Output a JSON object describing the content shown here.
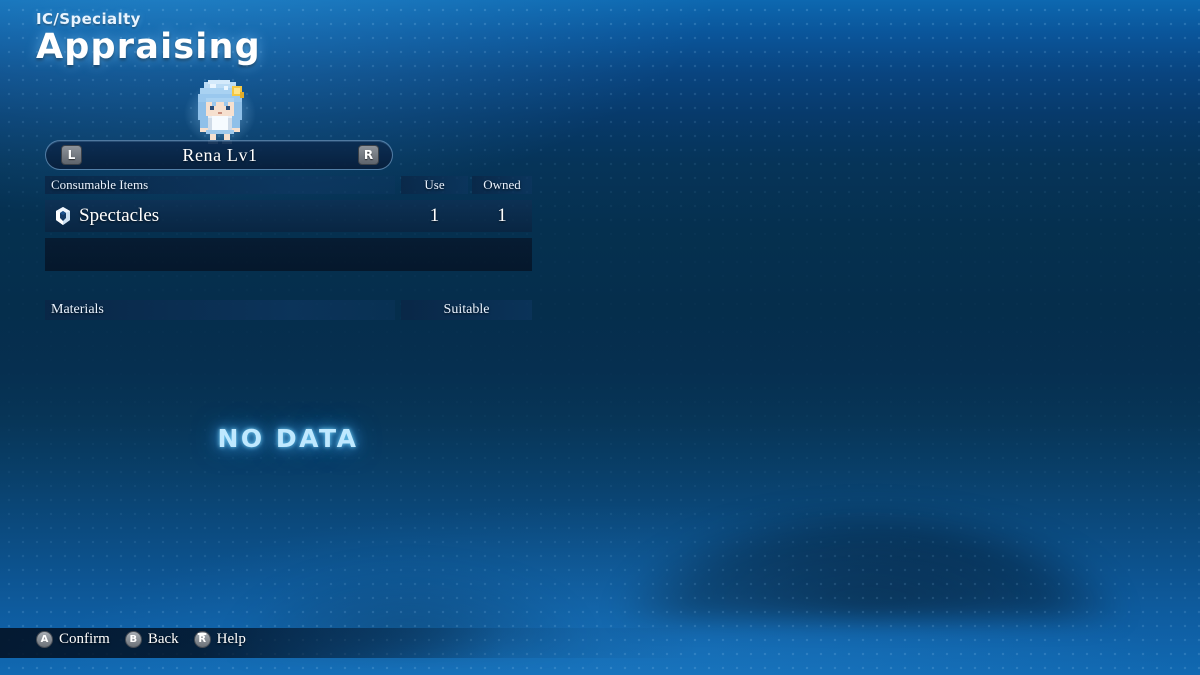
{
  "header": {
    "category": "IC/Specialty",
    "title": "Appraising"
  },
  "character": {
    "name_level": "Rena Lv1",
    "prev_button": "L",
    "next_button": "R",
    "sprite_name": "rena-sprite"
  },
  "consumables": {
    "headers": {
      "name": "Consumable Items",
      "use": "Use",
      "owned": "Owned"
    },
    "rows": [
      {
        "icon": "gem-icon",
        "name": "Spectacles",
        "use": "1",
        "owned": "1"
      }
    ]
  },
  "materials": {
    "headers": {
      "name": "Materials",
      "suitable": "Suitable"
    },
    "empty_message": "NO DATA"
  },
  "footer": {
    "prompts": [
      {
        "button": "A",
        "label": "Confirm",
        "glyph": "a-button-icon"
      },
      {
        "button": "B",
        "label": "Back",
        "glyph": "b-button-icon"
      },
      {
        "button": "R",
        "label": "Help",
        "glyph": "right-stick-icon"
      }
    ]
  },
  "colors": {
    "accent_cyan": "#bfe9ff",
    "bg_deep": "#052e4c",
    "bg_top": "#0d68b0",
    "panel": "#0a2646",
    "text": "#ffffff"
  }
}
